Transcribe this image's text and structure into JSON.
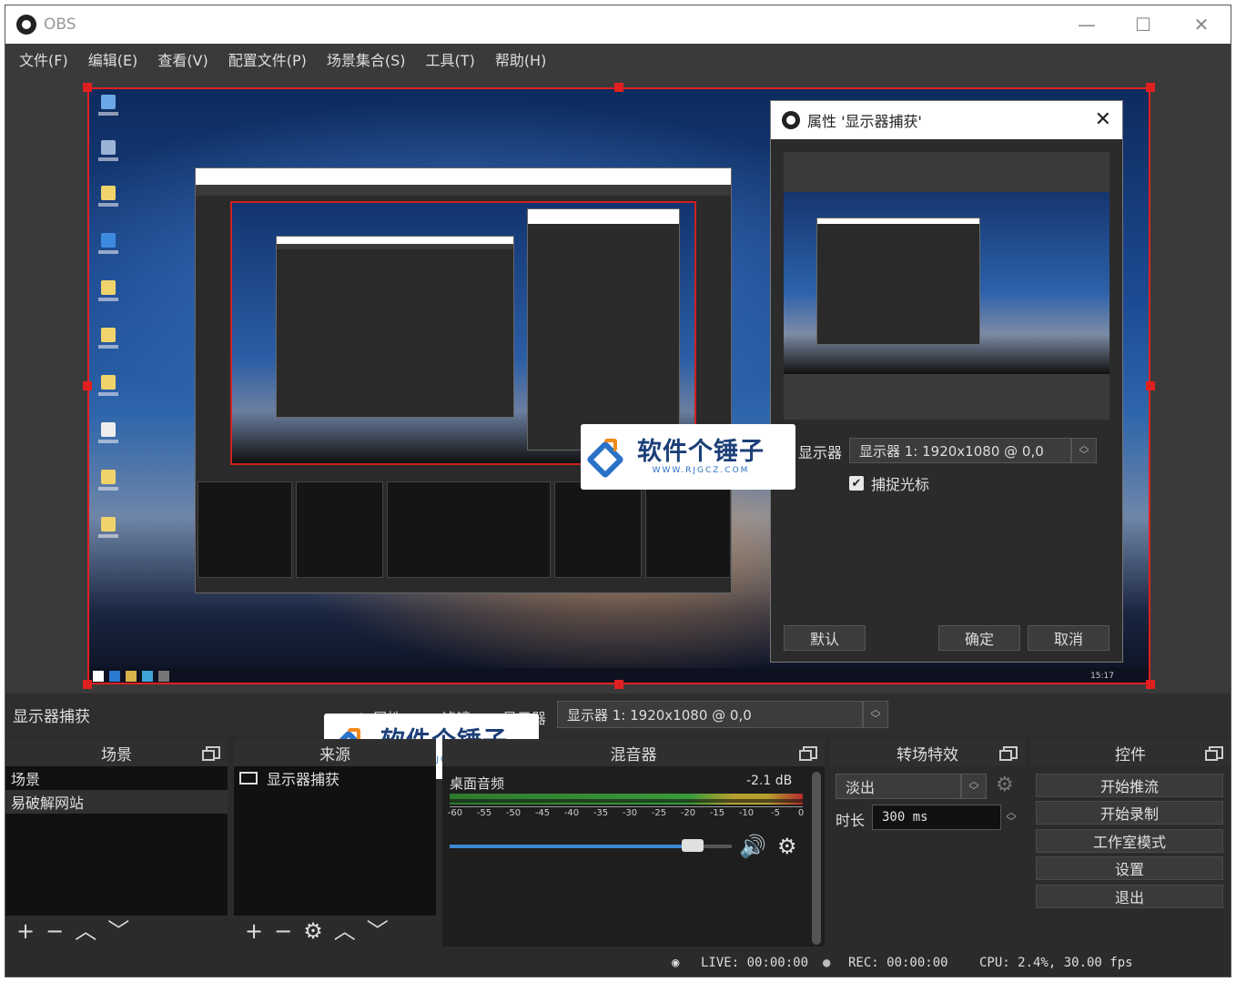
{
  "window": {
    "title": "OBS"
  },
  "menu": [
    "文件(F)",
    "编辑(E)",
    "查看(V)",
    "配置文件(P)",
    "场景集合(S)",
    "工具(T)",
    "帮助(H)"
  ],
  "properties_dialog": {
    "title": "属性 '显示器捕获'",
    "display_label": "显示器",
    "display_value": "显示器 1: 1920x1080 @ 0,0",
    "capture_cursor_label": "捕捉光标",
    "capture_cursor_checked": true,
    "default_button": "默认",
    "ok_button": "确定",
    "cancel_button": "取消"
  },
  "watermark": {
    "cn": "软件个锤子",
    "en": "WWW.RJGCZ.COM"
  },
  "source_toolbar": {
    "source_name": "显示器捕获",
    "properties_label": "属性",
    "filters_label": "滤镜",
    "display_label": "显示器",
    "display_value": "显示器 1: 1920x1080 @ 0,0"
  },
  "scenes": {
    "title": "场景",
    "items": [
      "场景",
      "易破解网站"
    ]
  },
  "sources": {
    "title": "来源",
    "items": [
      "显示器捕获"
    ]
  },
  "mixer": {
    "title": "混音器",
    "channel": "桌面音频",
    "db": "-2.1 dB",
    "scale": [
      "-60",
      "-55",
      "-50",
      "-45",
      "-40",
      "-35",
      "-30",
      "-25",
      "-20",
      "-15",
      "-10",
      "-5",
      "0"
    ],
    "volume_fraction": 0.86
  },
  "transitions": {
    "title": "转场特效",
    "selected": "淡出",
    "duration_label": "时长",
    "duration_value": "300 ms"
  },
  "controls": {
    "title": "控件",
    "buttons": [
      "开始推流",
      "开始录制",
      "工作室模式",
      "设置",
      "退出"
    ]
  },
  "status": {
    "live": "LIVE: 00:00:00",
    "rec": "REC: 00:00:00",
    "cpu": "CPU: 2.4%, 30.00 fps"
  }
}
